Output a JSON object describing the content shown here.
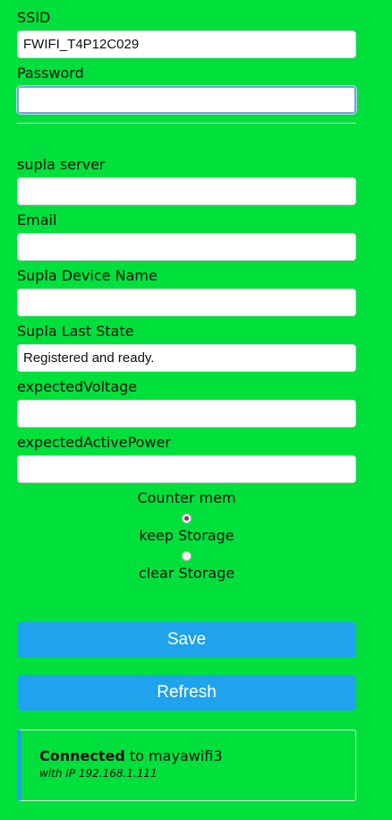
{
  "wifi": {
    "ssid_label": "SSID",
    "ssid_value": "FWIFI_T4P12C029",
    "password_label": "Password",
    "password_value": ""
  },
  "supla": {
    "server_label": "supla server",
    "server_value": "",
    "email_label": "Email",
    "email_value": "",
    "device_name_label": "Supla Device Name",
    "device_name_value": "",
    "last_state_label": "Supla Last State",
    "last_state_value": "Registered and ready.",
    "expected_voltage_label": "expectedVoltage",
    "expected_voltage_value": "",
    "expected_active_power_label": "expectedActivePower",
    "expected_active_power_value": ""
  },
  "counter": {
    "title": "Counter mem",
    "options": [
      {
        "label": "keep Storage",
        "checked": true
      },
      {
        "label": "clear Storage",
        "checked": false
      }
    ]
  },
  "buttons": {
    "save_label": "Save",
    "refresh_label": "Refresh"
  },
  "status": {
    "connected_word": "Connected",
    "connected_rest": " to mayawifi3",
    "ip_line": "with IP 192.168.1.111"
  },
  "colors": {
    "background": "#00e03c",
    "button": "#1fa3ec",
    "status_accent": "#1fa3ec"
  }
}
